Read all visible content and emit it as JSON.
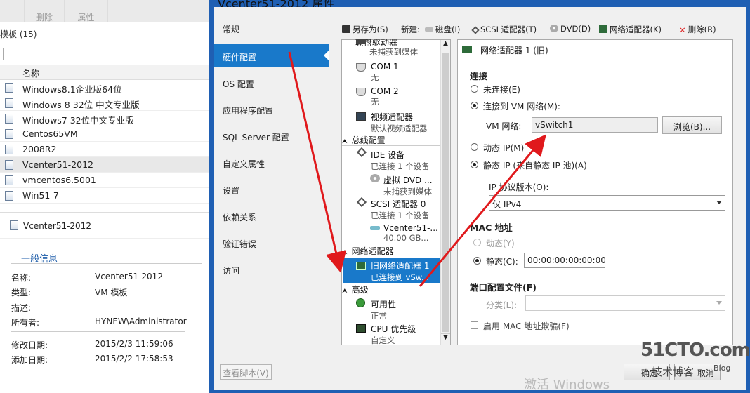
{
  "left_toolbar": {
    "delete_label": "删除",
    "properties_label": "属性"
  },
  "templates_header": "模板 (15)",
  "column_name": "名称",
  "templates": [
    "Windows8.1企业版64位",
    "Windows 8 32位 中文专业版",
    "Windows7 32位中文专业版",
    "Centos65VM",
    "2008R2",
    "Vcenter51-2012",
    "vmcentos6.5001",
    "Win51-7"
  ],
  "selected_template": "Vcenter51-2012",
  "general_info": {
    "title": "一般信息",
    "rows": [
      {
        "key": "名称:",
        "value": "Vcenter51-2012"
      },
      {
        "key": "类型:",
        "value": "VM 模板"
      },
      {
        "key": "描述:",
        "value": ""
      },
      {
        "key": "所有者:",
        "value": "HYNEW\\Administrator"
      },
      {
        "key": "修改日期:",
        "value": "2015/2/3 11:59:06"
      },
      {
        "key": "添加日期:",
        "value": "2015/2/2 17:58:53"
      }
    ]
  },
  "dialog": {
    "title": "Vcenter51-2012 属性",
    "nav": [
      "常规",
      "硬件配置",
      "OS 配置",
      "应用程序配置",
      "SQL Server 配置",
      "自定义属性",
      "设置",
      "依赖关系",
      "验证错误",
      "访问"
    ],
    "active_nav": "硬件配置",
    "view_script": "查看脚本(V)",
    "ok": "确定",
    "cancel": "取消"
  },
  "hw_toolbar": {
    "save_as": "另存为(S)",
    "new_label": "新建:",
    "disk": "磁盘(I)",
    "scsi": "SCSI 适配器(T)",
    "dvd": "DVD(D)",
    "nic": "网络适配器(K)",
    "delete": "删除(R)"
  },
  "tree": {
    "floppy": {
      "name": "软盘驱动器",
      "sub": "未捕获到媒体"
    },
    "com1": {
      "name": "COM 1",
      "sub": "无"
    },
    "com2": {
      "name": "COM 2",
      "sub": "无"
    },
    "video": {
      "name": "视频适配器",
      "sub": "默认视频适配器"
    },
    "bus_section": "总线配置",
    "ide": {
      "name": "IDE 设备",
      "sub": "已连接 1 个设备"
    },
    "vdvd": {
      "name": "虚拟 DVD ...",
      "sub": "未捕获到媒体"
    },
    "scsi0": {
      "name": "SCSI 适配器 0",
      "sub": "已连接 1 个设备"
    },
    "vdisk": {
      "name": "Vcenter51-...",
      "sub": "40.00 GB..."
    },
    "net_section": "网络适配器",
    "nic1": {
      "name": "旧网络适配器 1",
      "sub": "已连接到 vSw..."
    },
    "adv_section": "高级",
    "avail": {
      "name": "可用性",
      "sub": "正常"
    },
    "cpu": {
      "name": "CPU 优先级",
      "sub": "自定义"
    }
  },
  "details": {
    "header": "网络适配器 1 (旧)",
    "connection_group": "连接",
    "not_connected": "未连接(E)",
    "connect_vm": "连接到 VM 网络(M):",
    "vm_network_label": "VM 网络:",
    "vm_network_value": "vSwitch1",
    "browse": "浏览(B)...",
    "dynamic_ip": "动态 IP(M)",
    "static_ip": "静态 IP (来自静态 IP 池)(A)",
    "ip_protocol_label": "IP 协议版本(O):",
    "ip_protocol_value": "仅 IPv4",
    "mac_group": "MAC 地址",
    "mac_dynamic": "动态(Y)",
    "mac_static": "静态(C):",
    "mac_value": "00:00:00:00:00:00",
    "port_profile_group": "端口配置文件(F)",
    "classification_label": "分类(L):",
    "classification_value": "",
    "spoofing": "启用 MAC 地址欺骗(F)"
  },
  "watermark": {
    "logo": "51CTO.com",
    "sub": "技术博客",
    "blog": "Blog",
    "activate": "激活 Windows"
  },
  "colors": {
    "accent": "#1979ca",
    "dialog_frame": "#1f5fb3",
    "arrow": "#e0191c"
  }
}
